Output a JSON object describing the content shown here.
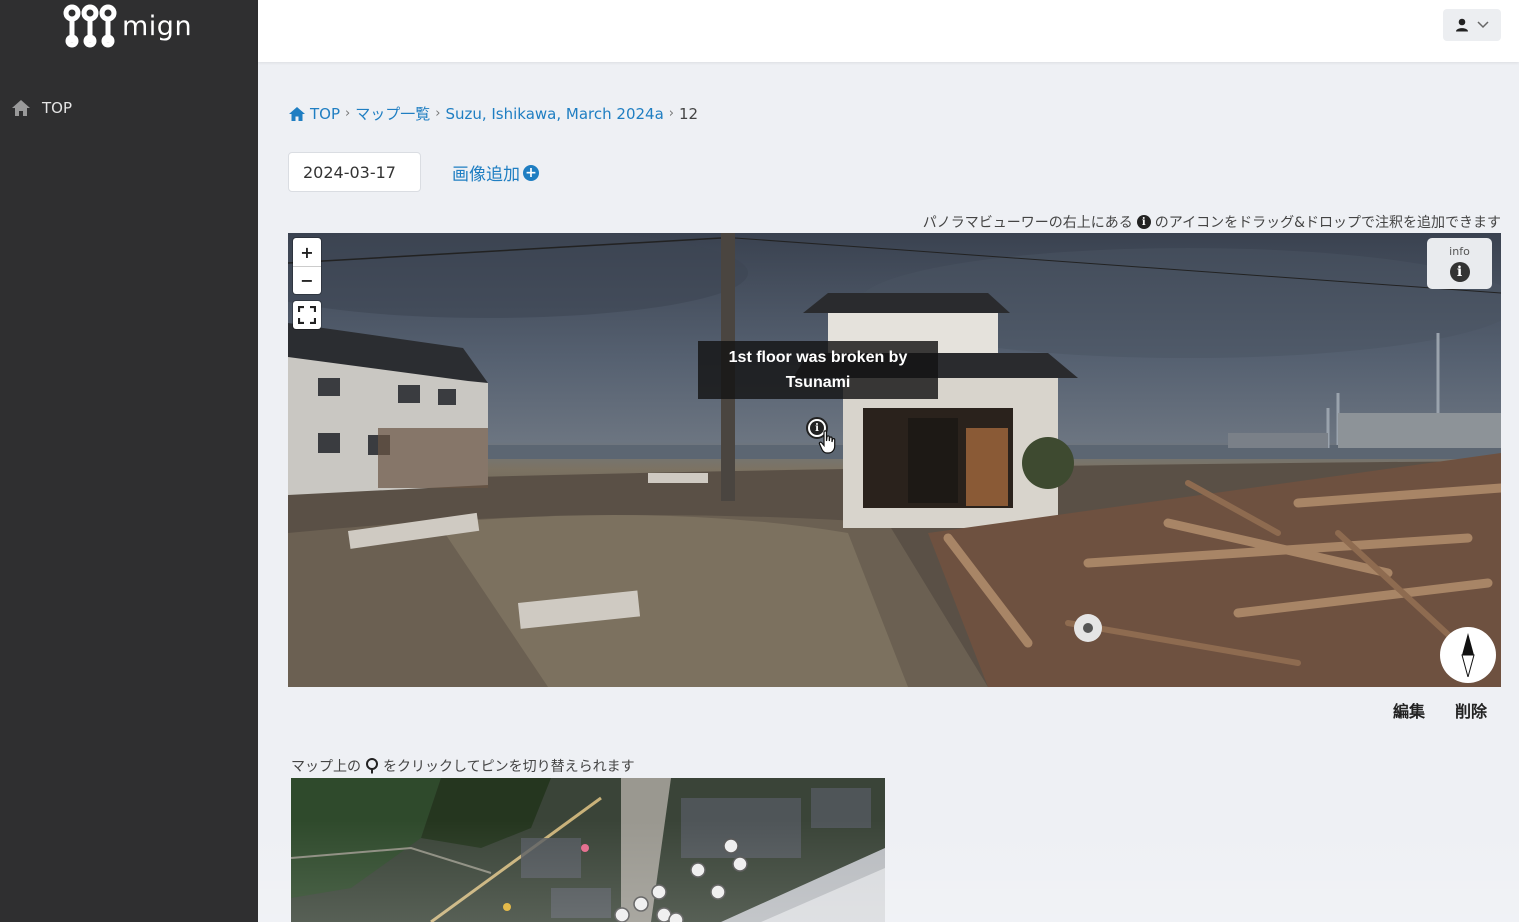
{
  "app": {
    "logo_text": "mign"
  },
  "sidebar": {
    "items": [
      {
        "label": "TOP",
        "icon": "home-icon"
      }
    ]
  },
  "header": {
    "user_menu_icon": "user-icon"
  },
  "breadcrumb": {
    "items": [
      "TOP",
      "マップ一覧",
      "Suzu, Ishikawa, March 2024a"
    ],
    "current": "12"
  },
  "controls": {
    "date_value": "2024-03-17",
    "add_image_label": "画像追加"
  },
  "panorama": {
    "hint_before": "パノラマビューワーの右上にある",
    "hint_after": "のアイコンをドラッグ&ドロップで注釈を追加できます",
    "zoom_in": "+",
    "zoom_out": "−",
    "info_label": "info",
    "annotation_text": "1st floor was broken by Tsunami"
  },
  "actions": {
    "edit_label": "編集",
    "delete_label": "削除"
  },
  "map": {
    "hint_before": "マップ上の",
    "hint_after": "をクリックしてピンを切り替えられます"
  },
  "colors": {
    "accent": "#1f7ec2",
    "sidebar_bg": "#2f2f30",
    "page_bg": "#eef0f4"
  }
}
